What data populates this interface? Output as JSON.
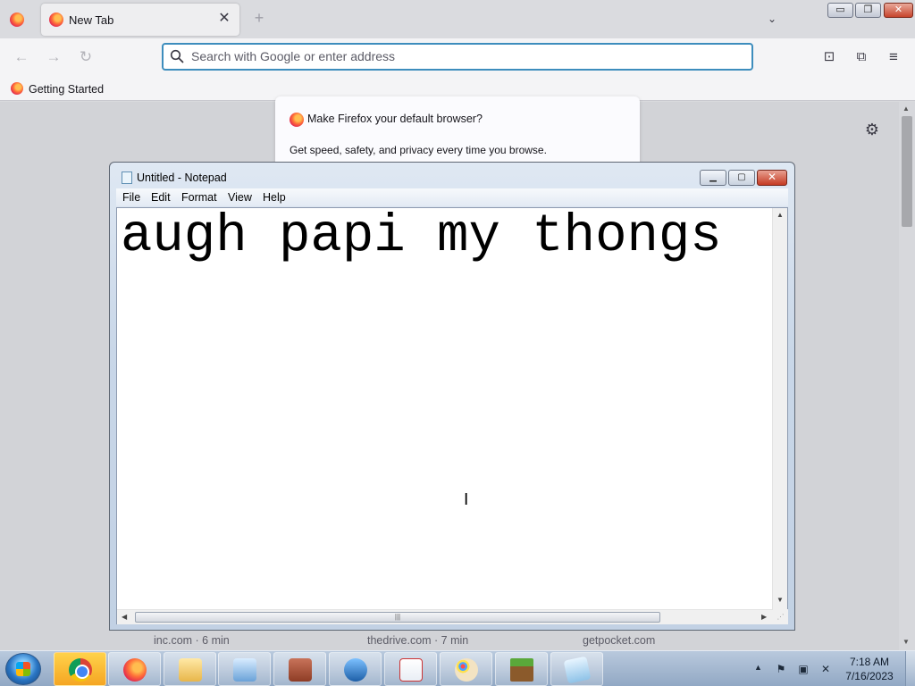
{
  "firefox": {
    "tab": {
      "title": "New Tab",
      "close_glyph": "✕"
    },
    "new_tab_glyph": "+",
    "tab_list_glyph": "⌄",
    "window_buttons": {
      "minimize": "▭",
      "maximize": "❐",
      "close": "✕"
    },
    "nav": {
      "back": "←",
      "forward": "→",
      "reload": "↻"
    },
    "urlbar": {
      "value": "",
      "placeholder": "Search with Google or enter address"
    },
    "toolbar_icons": {
      "pocket": "⊡",
      "extensions": "⧉",
      "menu": "≡"
    },
    "bookmarks": [
      {
        "label": "Getting Started"
      }
    ],
    "default_browser_prompt": {
      "title": "Make Firefox your default browser?",
      "body": "Get speed, safety, and privacy every time you browse."
    },
    "settings_glyph": "⚙",
    "stories": [
      {
        "source": "inc.com · 6 min"
      },
      {
        "source": "thedrive.com · 7 min"
      },
      {
        "source": "getpocket.com"
      }
    ]
  },
  "notepad": {
    "title": "Untitled - Notepad",
    "menu": [
      "File",
      "Edit",
      "Format",
      "View",
      "Help"
    ],
    "text": "augh papi my thongs",
    "caption_buttons": {
      "minimize": "▁",
      "maximize": "▢",
      "close": "✕"
    }
  },
  "taskbar": {
    "pinned": [
      {
        "name": "Google Chrome",
        "icon": "chrome-icon"
      },
      {
        "name": "Firefox",
        "icon": "firefox-icon"
      },
      {
        "name": "Windows Explorer",
        "icon": "folder-icon"
      },
      {
        "name": "Control Panel",
        "icon": "control-panel-icon"
      },
      {
        "name": "Firewall",
        "icon": "firewall-icon"
      },
      {
        "name": "Network",
        "icon": "network-icon"
      },
      {
        "name": "Java",
        "icon": "java-icon"
      },
      {
        "name": "Paint",
        "icon": "paint-icon"
      },
      {
        "name": "Minecraft",
        "icon": "minecraft-icon"
      },
      {
        "name": "Notepad",
        "icon": "notepad-icon"
      }
    ],
    "tray": {
      "up_glyph": "▲",
      "flag_glyph": "⚑",
      "network_glyph": "▣",
      "volume_glyph": "✕"
    },
    "clock": {
      "time": "7:18 AM",
      "date": "7/16/2023"
    }
  },
  "colors": {
    "urlbar_focus": "#3d8dbd",
    "taskbar_top": "#b9c9dd",
    "notepad_frame": "#c9d7e8"
  }
}
